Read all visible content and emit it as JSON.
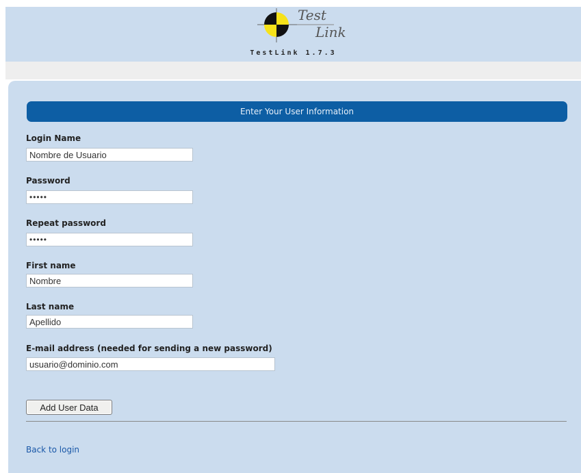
{
  "header": {
    "logo_word1": "Test",
    "logo_word2": "Link",
    "app_version": "TestLink 1.7.3"
  },
  "form": {
    "title": "Enter Your User Information",
    "fields": {
      "login": {
        "label": "Login Name",
        "value": "Nombre de Usuario"
      },
      "password": {
        "label": "Password",
        "value": "•••••"
      },
      "repeat_password": {
        "label": "Repeat password",
        "value": "•••••"
      },
      "first_name": {
        "label": "First name",
        "value": "Nombre"
      },
      "last_name": {
        "label": "Last name",
        "value": "Apellido"
      },
      "email": {
        "label": "E-mail address (needed for sending a new password)",
        "value": "usuario@dominio.com"
      }
    },
    "submit_label": "Add User Data"
  },
  "back_link_label": "Back to login",
  "colors": {
    "panel_bg": "#cbdcee",
    "title_bar": "#0d5ea4",
    "link": "#1a58a8"
  }
}
